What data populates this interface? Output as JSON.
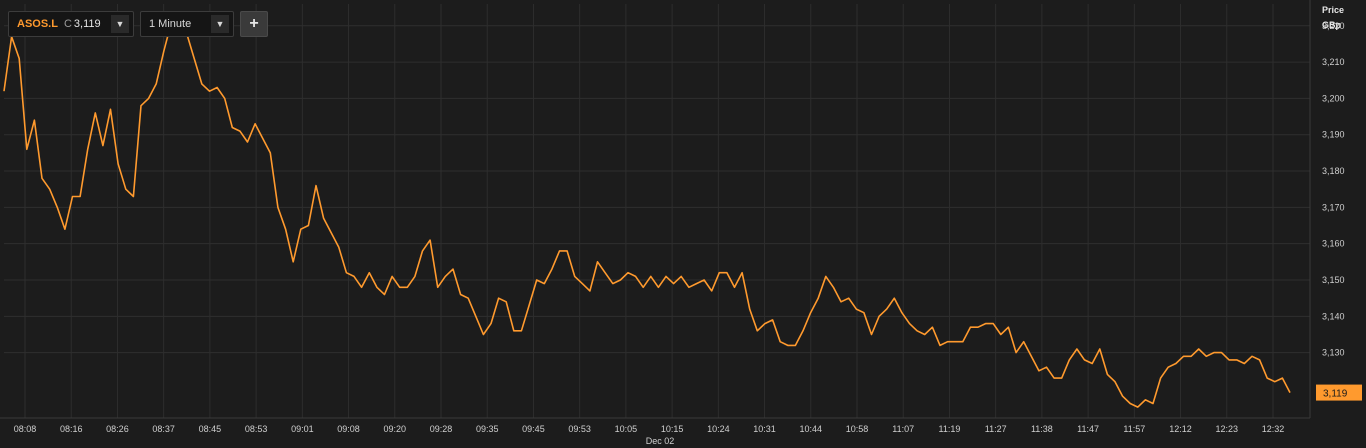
{
  "toolbar": {
    "symbol": "ASOS.L",
    "close_label": "C",
    "close_value": "3,119",
    "interval": "1 Minute",
    "add_label": "+",
    "dropdown_glyph": "▼"
  },
  "colors": {
    "background": "#1c1c1c",
    "grid": "#2e2e2e",
    "line": "#ff9a2e",
    "price_tag": "#ff9a2e"
  },
  "chart_data": {
    "type": "line",
    "title": "",
    "ylabel": "Price",
    "yunit": "GBp",
    "xlabel": "",
    "date_label": "Dec 02",
    "ylim": [
      3112,
      3226
    ],
    "yticks": [
      3130,
      3140,
      3150,
      3160,
      3170,
      3180,
      3190,
      3200,
      3210,
      3220
    ],
    "ytick_labels": [
      "3,130",
      "3,140",
      "3,150",
      "3,160",
      "3,170",
      "3,180",
      "3,190",
      "3,200",
      "3,210",
      "3,220"
    ],
    "xtick_labels": [
      "08:08",
      "08:16",
      "08:26",
      "08:37",
      "08:45",
      "08:53",
      "09:01",
      "09:08",
      "09:20",
      "09:28",
      "09:35",
      "09:45",
      "09:53",
      "10:05",
      "10:15",
      "10:24",
      "10:31",
      "10:44",
      "10:58",
      "11:07",
      "11:19",
      "11:27",
      "11:38",
      "11:47",
      "11:57",
      "12:12",
      "12:23",
      "12:32"
    ],
    "last_value": 3119,
    "last_value_label": "3,119",
    "grid": true,
    "series": [
      {
        "values": [
          3202,
          3217,
          3211,
          3186,
          3194,
          3178,
          3175,
          3170,
          3164,
          3173,
          3173,
          3186,
          3196,
          3187,
          3197,
          3182,
          3175,
          3173,
          3198,
          3200,
          3204,
          3213,
          3221,
          3221,
          3218,
          3211,
          3204,
          3202,
          3203,
          3200,
          3192,
          3191,
          3188,
          3193,
          3189,
          3185,
          3170,
          3164,
          3155,
          3164,
          3165,
          3176,
          3167,
          3163,
          3159,
          3152,
          3151,
          3148,
          3152,
          3148,
          3146,
          3151,
          3148,
          3148,
          3151,
          3158,
          3161,
          3148,
          3151,
          3153,
          3146,
          3145,
          3140,
          3135,
          3138,
          3145,
          3144,
          3136,
          3136,
          3143,
          3150,
          3149,
          3153,
          3158,
          3158,
          3151,
          3149,
          3147,
          3155,
          3152,
          3149,
          3150,
          3152,
          3151,
          3148,
          3151,
          3148,
          3151,
          3149,
          3151,
          3148,
          3149,
          3150,
          3147,
          3152,
          3152,
          3148,
          3152,
          3142,
          3136,
          3138,
          3139,
          3133,
          3132,
          3132,
          3136,
          3141,
          3145,
          3151,
          3148,
          3144,
          3145,
          3142,
          3141,
          3135,
          3140,
          3142,
          3145,
          3141,
          3138,
          3136,
          3135,
          3137,
          3132,
          3133,
          3133,
          3133,
          3137,
          3137,
          3138,
          3138,
          3135,
          3137,
          3130,
          3133,
          3129,
          3125,
          3126,
          3123,
          3123,
          3128,
          3131,
          3128,
          3127,
          3131,
          3124,
          3122,
          3118,
          3116,
          3115,
          3117,
          3116,
          3123,
          3126,
          3127,
          3129,
          3129,
          3131,
          3129,
          3130,
          3130,
          3128,
          3128,
          3127,
          3129,
          3128,
          3123,
          3122,
          3123,
          3119
        ]
      }
    ]
  }
}
